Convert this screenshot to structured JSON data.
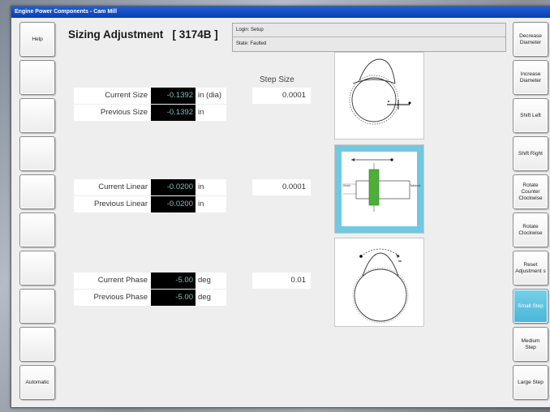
{
  "window": {
    "title": "Engine Power Components - Cam Mill"
  },
  "heading": {
    "title": "Sizing Adjustment",
    "id": "[ 3174B ]"
  },
  "status": {
    "login": "Login: Setup",
    "state": "State: Faulted"
  },
  "left_buttons": [
    {
      "label": "Help"
    },
    {
      "label": ""
    },
    {
      "label": ""
    },
    {
      "label": ""
    },
    {
      "label": ""
    },
    {
      "label": ""
    },
    {
      "label": ""
    },
    {
      "label": ""
    },
    {
      "label": ""
    },
    {
      "label": "Automatic"
    }
  ],
  "right_buttons": [
    {
      "label": "Decrease Diameter"
    },
    {
      "label": "Increase Diameter"
    },
    {
      "label": "Shift Left"
    },
    {
      "label": "Shift Right"
    },
    {
      "label": "Rotate Counter Clockwise"
    },
    {
      "label": "Rotate Clockwise"
    },
    {
      "label": "Reset Adjustment s"
    },
    {
      "label": "Small Step"
    },
    {
      "label": "Medium Step"
    },
    {
      "label": "Large Step"
    }
  ],
  "step_size_label": "Step Size",
  "size": {
    "current_label": "Current Size",
    "current_value": "-0.1392",
    "current_unit": "in (dia)",
    "previous_label": "Previous Size",
    "previous_value": "-0.1392",
    "previous_unit": "in",
    "step": "0.0001"
  },
  "linear": {
    "current_label": "Current Linear",
    "current_value": "-0.0200",
    "current_unit": "in",
    "previous_label": "Previous Linear",
    "previous_value": "-0.0200",
    "previous_unit": "in",
    "step": "0.0001"
  },
  "phase": {
    "current_label": "Current Phase",
    "current_value": "-5.00",
    "current_unit": "deg",
    "previous_label": "Previous Phase",
    "previous_value": "-5.00",
    "previous_unit": "deg",
    "step": "0.01"
  },
  "diagram_linear": {
    "left_label": "Chuck",
    "right_label": "Tailstock"
  },
  "colors": {
    "title_bar": "#1e5fd6",
    "active_button": "#49b6d8",
    "linear_block": "#4caf3a",
    "diagram_frame": "#70c9e0"
  },
  "icons": [
    "cam-diameter-icon",
    "linear-shift-icon",
    "phase-rotation-icon"
  ]
}
